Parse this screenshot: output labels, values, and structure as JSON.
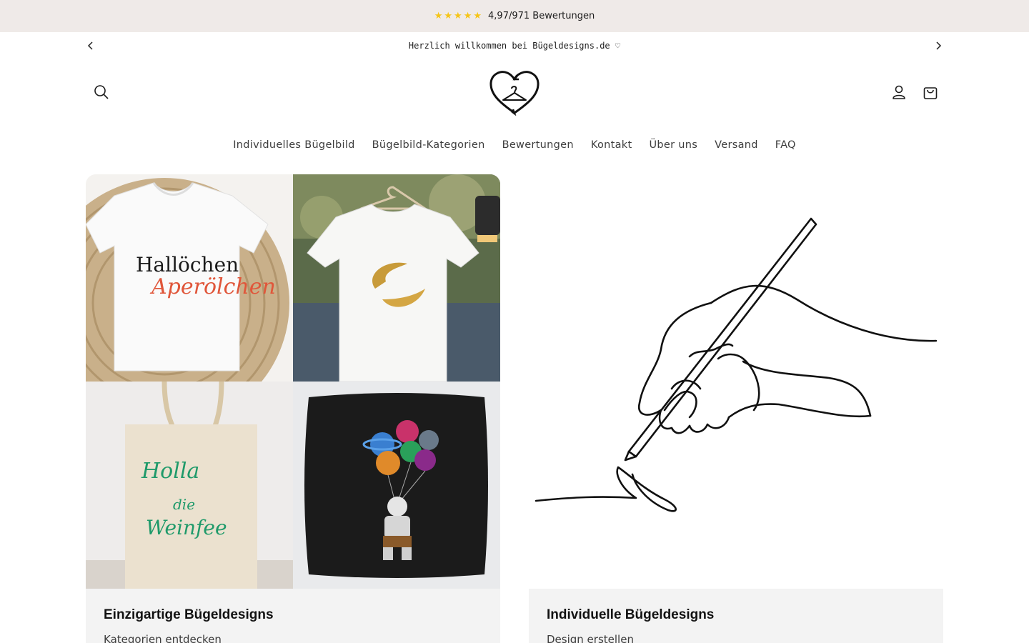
{
  "rating_bar": {
    "stars": "★★★★★",
    "text": "4,97/971 Bewertungen"
  },
  "announcement": {
    "text": "Herzlich willkommen bei Bügeldesigns.de ♡"
  },
  "header": {
    "logo_name": "heart-hanger-logo"
  },
  "nav": {
    "items": [
      {
        "label": "Individuelles Bügelbild"
      },
      {
        "label": "Bügelbild-Kategorien"
      },
      {
        "label": "Bewertungen"
      },
      {
        "label": "Kontakt"
      },
      {
        "label": "Über uns"
      },
      {
        "label": "Versand"
      },
      {
        "label": "FAQ"
      }
    ]
  },
  "cards": [
    {
      "title": "Einzigartige Bügeldesigns",
      "subtitle": "Kategorien entdecken",
      "tiles": [
        {
          "line1": "Hallöchen",
          "line2": "Aperölchen"
        },
        {
          "caption": ""
        },
        {
          "line1": "Holla",
          "line2": "die",
          "line3": "Weinfee"
        },
        {
          "caption": ""
        }
      ]
    },
    {
      "title": "Individuelle Bügeldesigns",
      "subtitle": "Design erstellen"
    }
  ],
  "colors": {
    "rating_bg": "#efeae8",
    "star": "#f5c518",
    "card_foot_bg": "#f3f3f3",
    "text_dark": "#121212",
    "nav_text": "#3d3d3d"
  }
}
